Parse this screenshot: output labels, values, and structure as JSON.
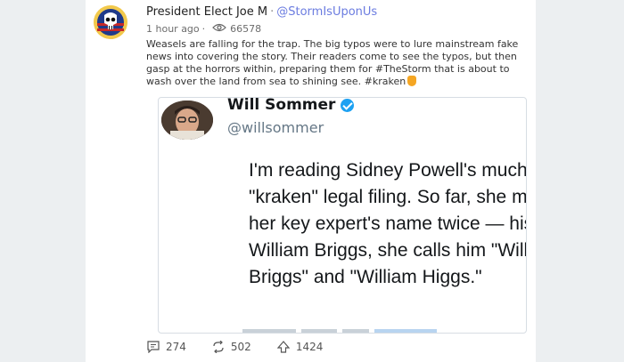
{
  "post": {
    "author": "President Elect Joe M",
    "separator": "·",
    "handle": "@StormIsUponUs",
    "time": "1 hour ago",
    "views_separator": "·",
    "views": "66578",
    "text": "Weasels are falling for the trap. The big typos were to lure mainstream fake news into covering the story. Their readers come to see the typos, but then gasp at the horrors within, preparing them for #TheStorm that is about to wash over the land from sea to shining see. #kraken"
  },
  "embed": {
    "name": "Will Sommer",
    "handle": "@willsommer",
    "text": "I'm reading Sidney Powell's much-hyped \"kraken\" legal filing. So far, she misspells her key expert's name twice — his name is William Briggs, she calls him \"Williams Briggs\" and \"William Higgs.\""
  },
  "actions": {
    "replies": "274",
    "reposts": "502",
    "likes": "1424"
  },
  "icons": {
    "avatar": "punisher-skull-avatar-icon",
    "views": "eye-icon",
    "emoji": "pointing-hand-icon",
    "verified": "verified-badge-icon",
    "reply": "comment-icon",
    "repost": "repost-icon",
    "like": "upvote-icon"
  },
  "colors": {
    "handle": "#6b7ce0",
    "verified": "#1da1f2",
    "background": "#eceff1"
  }
}
